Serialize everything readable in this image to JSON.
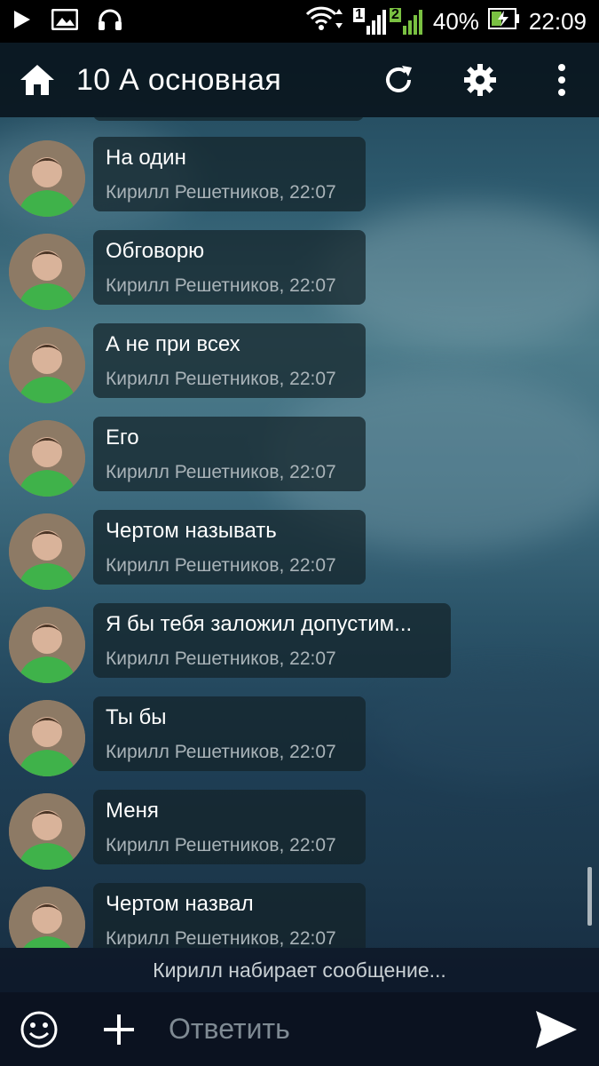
{
  "status_bar": {
    "sim1_label": "1",
    "sim2_label": "2",
    "battery": "40%",
    "time": "22:09",
    "icons": [
      "play-icon",
      "image-icon",
      "headphones-icon",
      "wifi-icon",
      "signal-icon",
      "battery-icon"
    ]
  },
  "header": {
    "title": "10 А основная",
    "icons": [
      "home-icon",
      "refresh-icon",
      "gear-icon",
      "more-vert-icon"
    ]
  },
  "messages": [
    {
      "text": "На один",
      "author": "Кирилл Решетников, 22:07"
    },
    {
      "text": "Обговорю",
      "author": "Кирилл Решетников, 22:07"
    },
    {
      "text": "А не при всех",
      "author": "Кирилл Решетников, 22:07"
    },
    {
      "text": "Его",
      "author": "Кирилл Решетников, 22:07"
    },
    {
      "text": "Чертом называть",
      "author": "Кирилл Решетников, 22:07"
    },
    {
      "text": "Я бы тебя заложил допустим...",
      "author": "Кирилл Решетников, 22:07"
    },
    {
      "text": "Ты бы",
      "author": "Кирилл Решетников, 22:07"
    },
    {
      "text": "Меня",
      "author": "Кирилл Решетников, 22:07"
    },
    {
      "text": "Чертом назвал",
      "author": "Кирилл Решетников, 22:07"
    }
  ],
  "typing_status": "Кирилл набирает сообщение...",
  "composer": {
    "placeholder": "Ответить",
    "icons": [
      "emoji-icon",
      "add-icon",
      "send-icon"
    ]
  },
  "colors": {
    "header_bg": "#0a161e",
    "bubble_bg": "#142228",
    "meta_text": "#a9b3b8",
    "input_bar_bg": "#0b1220"
  }
}
